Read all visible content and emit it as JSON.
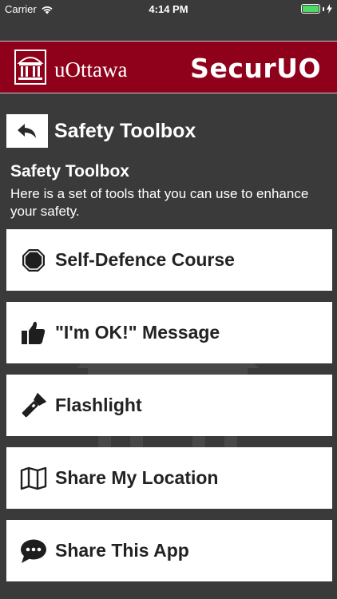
{
  "status_bar": {
    "carrier": "Carrier",
    "time": "4:14 PM"
  },
  "brand": {
    "university_name": "uOttawa",
    "app_name": "SecurUO",
    "color": "#8f001a"
  },
  "header": {
    "title": "Safety Toolbox",
    "back_icon": "back-arrow-icon"
  },
  "intro": {
    "heading": "Safety Toolbox",
    "description": "Here is a set of tools that you can use to enhance your safety."
  },
  "tools": [
    {
      "label": "Self-Defence Course",
      "icon": "stop-sign-icon"
    },
    {
      "label": "\"I'm OK!\" Message",
      "icon": "thumbs-up-icon"
    },
    {
      "label": "Flashlight",
      "icon": "flashlight-icon"
    },
    {
      "label": "Share My Location",
      "icon": "map-icon"
    },
    {
      "label": "Share This App",
      "icon": "chat-bubble-icon"
    }
  ]
}
